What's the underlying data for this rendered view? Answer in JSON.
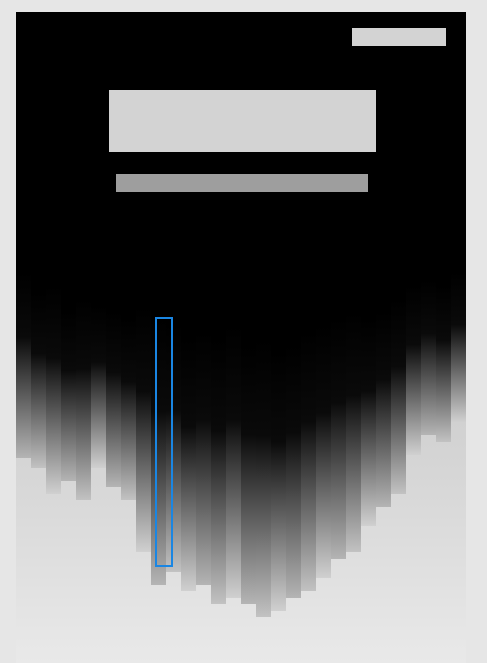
{
  "canvas": {
    "background": "#000000",
    "lower_fill": "#d9d9d9"
  },
  "placeholders": {
    "top_right_button": "",
    "title_block": "",
    "subtitle_block": ""
  },
  "bars": [
    {
      "top": 0.4,
      "bottom": 0.685
    },
    {
      "top": 0.43,
      "bottom": 0.7
    },
    {
      "top": 0.42,
      "bottom": 0.74
    },
    {
      "top": 0.46,
      "bottom": 0.72
    },
    {
      "top": 0.44,
      "bottom": 0.75
    },
    {
      "top": 0.45,
      "bottom": 0.7
    },
    {
      "top": 0.46,
      "bottom": 0.73
    },
    {
      "top": 0.47,
      "bottom": 0.75
    },
    {
      "top": 0.45,
      "bottom": 0.83
    },
    {
      "top": 0.47,
      "bottom": 0.88
    },
    {
      "top": 0.48,
      "bottom": 0.86
    },
    {
      "top": 0.5,
      "bottom": 0.89
    },
    {
      "top": 0.49,
      "bottom": 0.88
    },
    {
      "top": 0.5,
      "bottom": 0.91
    },
    {
      "top": 0.48,
      "bottom": 0.9
    },
    {
      "top": 0.51,
      "bottom": 0.91
    },
    {
      "top": 0.5,
      "bottom": 0.93
    },
    {
      "top": 0.52,
      "bottom": 0.92
    },
    {
      "top": 0.51,
      "bottom": 0.9
    },
    {
      "top": 0.49,
      "bottom": 0.89
    },
    {
      "top": 0.48,
      "bottom": 0.87
    },
    {
      "top": 0.47,
      "bottom": 0.84
    },
    {
      "top": 0.46,
      "bottom": 0.83
    },
    {
      "top": 0.47,
      "bottom": 0.79
    },
    {
      "top": 0.46,
      "bottom": 0.76
    },
    {
      "top": 0.44,
      "bottom": 0.74
    },
    {
      "top": 0.42,
      "bottom": 0.68
    },
    {
      "top": 0.41,
      "bottom": 0.65
    },
    {
      "top": 0.42,
      "bottom": 0.66
    },
    {
      "top": 0.4,
      "bottom": 0.63
    }
  ],
  "highlight": {
    "color": "#1a86e3",
    "bar_index": 9
  }
}
